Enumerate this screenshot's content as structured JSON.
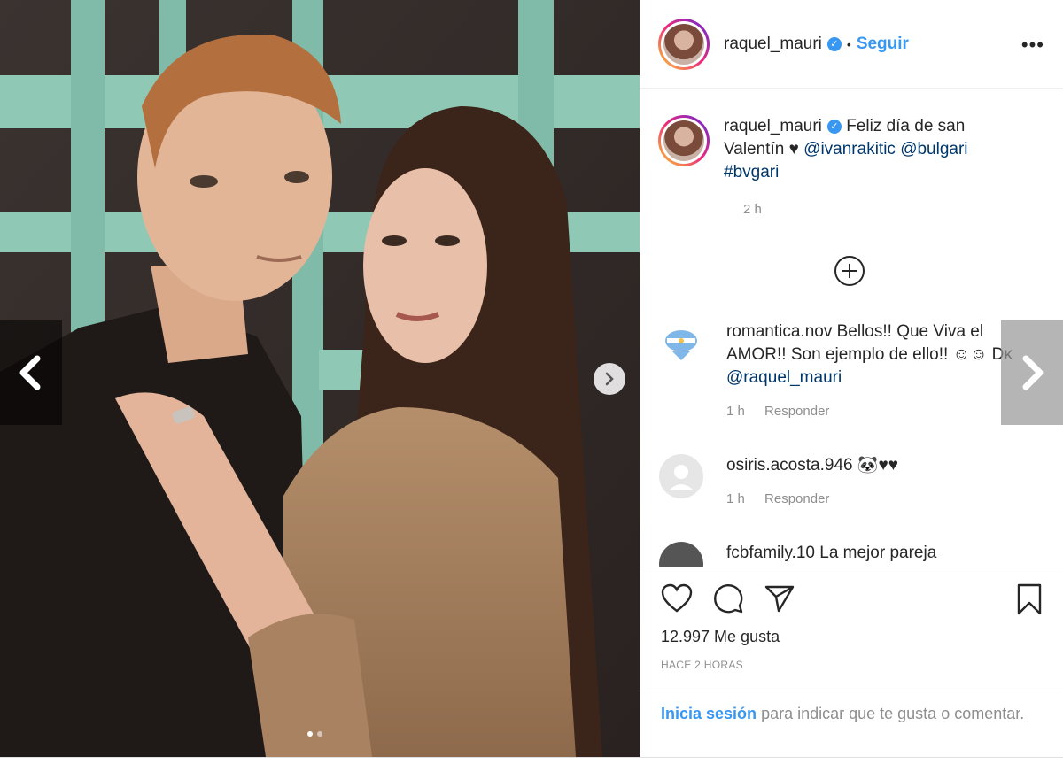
{
  "post": {
    "username": "raquel_mauri",
    "separator": "•",
    "follow_label": "Seguir",
    "more_label": "•••"
  },
  "caption": {
    "username": "raquel_mauri",
    "text_before": "Feliz día de san Valentín",
    "heart": "♥",
    "mention1": "@ivanrakitic",
    "mention2": "@bulgari",
    "hashtag": "#bvgari",
    "time": "2 h"
  },
  "comments": [
    {
      "username": "romantica.nov",
      "text": "Bellos!! Que Viva el AMOR!! Son ejemplo de ello!! ☺☺ Dĸ",
      "mention": "@raquel_mauri",
      "time": "1 h",
      "reply": "Responder"
    },
    {
      "username": "osiris.acosta.946",
      "text": "🐼♥♥",
      "time": "1 h",
      "reply": "Responder"
    },
    {
      "username": "fcbfamily.10",
      "text": "La mejor pareja"
    }
  ],
  "actions": {
    "likes": "12.997 Me gusta",
    "ago": "HACE 2 HORAS"
  },
  "login": {
    "link": "Inicia sesión",
    "text": "para indicar que te gusta o comentar."
  },
  "colors": {
    "accent": "#3897f0",
    "muted": "#8e8e8e",
    "text": "#262626"
  }
}
